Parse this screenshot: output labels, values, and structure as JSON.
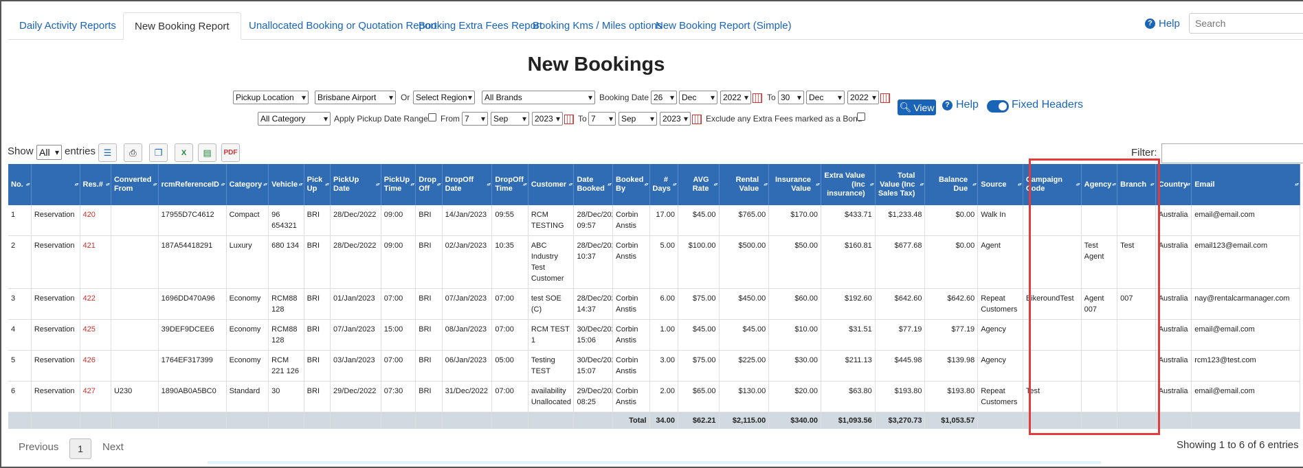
{
  "tabs": [
    {
      "label": "Daily Activity Reports"
    },
    {
      "label": "New Booking Report"
    },
    {
      "label": "Unallocated Booking or Quotation Report"
    },
    {
      "label": "Booking Extra Fees Report"
    },
    {
      "label": "Booking Kms / Miles options"
    },
    {
      "label": "New Booking Report (Simple)"
    }
  ],
  "header": {
    "help": "Help",
    "search_placeholder": "Search"
  },
  "title": "New Bookings",
  "filters": {
    "pickup_location": "Pickup Location",
    "location": "Brisbane Airport",
    "or": "Or",
    "region": "Select Region",
    "brands": "All Brands",
    "booking_date_label": "Booking Date",
    "from_day": "26",
    "from_month": "Dec",
    "from_year": "2022",
    "to_label": "To",
    "to_day": "30",
    "to_month": "Dec",
    "to_year": "2022",
    "category": "All Category",
    "apply_pickup_label": "Apply Pickup Date Range",
    "from_label": "From",
    "p_from_day": "7",
    "p_from_month": "Sep",
    "p_from_year": "2023",
    "p_to_day": "7",
    "p_to_month": "Sep",
    "p_to_year": "2023",
    "exclude_label": "Exclude any Extra Fees marked as a Bond",
    "view_label": "View",
    "help_label": "Help",
    "fixed_headers_label": "Fixed Headers"
  },
  "entries": {
    "show": "Show",
    "value": "All",
    "suffix": "entries",
    "filter_label": "Filter:"
  },
  "table": {
    "columns": [
      "No.",
      "",
      "Res.#",
      "Converted From",
      "rcmReferenceID",
      "Category",
      "Vehicle",
      "Pick Up",
      "PickUp Date",
      "PickUp Time",
      "Drop Off",
      "DropOff Date",
      "DropOff Time",
      "Customer",
      "Date Booked",
      "Booked By",
      "# Days",
      "AVG Rate",
      "Rental Value",
      "Insurance Value",
      "Extra Value (Inc insurance)",
      "Total Value (Inc Sales Tax)",
      "Balance Due",
      "Source",
      "Campaign Code",
      "Agency",
      "Branch",
      "Country",
      "Email"
    ],
    "rows": [
      [
        "1",
        "Reservation",
        "420",
        "",
        "17955D7C4612",
        "Compact",
        "96 654321",
        "BRI",
        "28/Dec/2022",
        "09:00",
        "BRI",
        "14/Jan/2023",
        "09:55",
        "RCM TESTING",
        "28/Dec/2022 09:57",
        "Corbin Anstis",
        "17.00",
        "$45.00",
        "$765.00",
        "$170.00",
        "$433.71",
        "$1,233.48",
        "$0.00",
        "Walk In",
        "",
        "",
        "",
        "Australia",
        "email@email.com"
      ],
      [
        "2",
        "Reservation",
        "421",
        "",
        "187A54418291",
        "Luxury",
        "680 134",
        "BRI",
        "28/Dec/2022",
        "09:00",
        "BRI",
        "02/Jan/2023",
        "10:35",
        "ABC Industry Test Customer",
        "28/Dec/2022 10:37",
        "Corbin Anstis",
        "5.00",
        "$100.00",
        "$500.00",
        "$50.00",
        "$160.81",
        "$677.68",
        "$0.00",
        "Agent",
        "",
        "Test Agent",
        "Test",
        "Australia",
        "email123@email.com"
      ],
      [
        "3",
        "Reservation",
        "422",
        "",
        "1696DD470A96",
        "Economy",
        "RCM88 128",
        "BRI",
        "01/Jan/2023",
        "07:00",
        "BRI",
        "07/Jan/2023",
        "07:00",
        "test SOE (C)",
        "28/Dec/2022 14:37",
        "Corbin Anstis",
        "6.00",
        "$75.00",
        "$450.00",
        "$60.00",
        "$192.60",
        "$642.60",
        "$642.60",
        "Repeat Customers",
        "BikeroundTest",
        "Agent 007",
        "007",
        "Australia",
        "nay@rentalcarmanager.com"
      ],
      [
        "4",
        "Reservation",
        "425",
        "",
        "39DEF9DCEE6",
        "Economy",
        "RCM88 128",
        "BRI",
        "07/Jan/2023",
        "15:00",
        "BRI",
        "08/Jan/2023",
        "07:00",
        "RCM TEST 1",
        "30/Dec/2022 15:06",
        "Corbin Anstis",
        "1.00",
        "$45.00",
        "$45.00",
        "$10.00",
        "$31.51",
        "$77.19",
        "$77.19",
        "Agency",
        "",
        "",
        "",
        "Australia",
        "email@email.com"
      ],
      [
        "5",
        "Reservation",
        "426",
        "",
        "1764EF317399",
        "Economy",
        "RCM 221 126",
        "BRI",
        "03/Jan/2023",
        "07:00",
        "BRI",
        "06/Jan/2023",
        "05:00",
        "Testing TEST",
        "30/Dec/2022 15:07",
        "Corbin Anstis",
        "3.00",
        "$75.00",
        "$225.00",
        "$30.00",
        "$211.13",
        "$445.98",
        "$139.98",
        "Agency",
        "",
        "",
        "",
        "Australia",
        "rcm123@test.com"
      ],
      [
        "6",
        "Reservation",
        "427",
        "U230",
        "1890AB0A5BC0",
        "Standard",
        "30",
        "BRI",
        "29/Dec/2022",
        "07:30",
        "BRI",
        "31/Dec/2022",
        "07:00",
        "availability Unallocated",
        "29/Dec/2022 08:25",
        "Corbin Anstis",
        "2.00",
        "$65.00",
        "$130.00",
        "$20.00",
        "$63.80",
        "$193.80",
        "$193.80",
        "Repeat Customers",
        "Test",
        "",
        "",
        "Australia",
        "email@email.com"
      ]
    ],
    "totals": {
      "label": "Total",
      "days": "34.00",
      "avg_rate": "$62.21",
      "rental": "$2,115.00",
      "insurance": "$340.00",
      "extra": "$1,093.56",
      "total_value": "$3,270.73",
      "balance": "$1,053.57"
    }
  },
  "footer": {
    "previous": "Previous",
    "page": "1",
    "next": "Next",
    "info": "Showing 1 to 6 of 6 entries"
  }
}
